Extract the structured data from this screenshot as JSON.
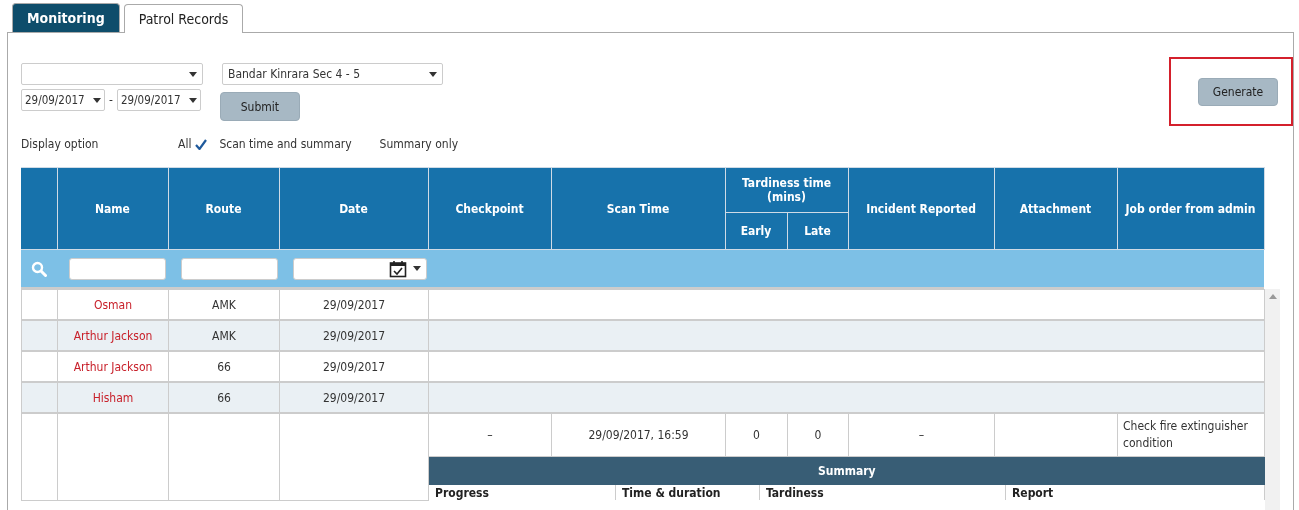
{
  "tabs": [
    {
      "label": "Monitoring",
      "selected": false
    },
    {
      "label": "Patrol Records",
      "selected": true
    }
  ],
  "filters": {
    "select_2": {
      "value": "Bandar Kinrara Sec 4 - 5"
    },
    "date_from": "29/09/2017",
    "date_separator": "-",
    "date_to": "29/09/2017",
    "submit": "Submit"
  },
  "generate_button": {
    "label": "Generate",
    "highlighted": true
  },
  "display_option": {
    "label": "Display option",
    "options": [
      {
        "label": "All",
        "selected": true
      },
      {
        "label": "Scan time and summary",
        "selected": false
      },
      {
        "label": "Summary only",
        "selected": false
      }
    ]
  },
  "table": {
    "columns": [
      {},
      {
        "label": "Name"
      },
      {
        "label": "Route"
      },
      {
        "label": "Date"
      },
      {
        "label": "Checkpoint"
      },
      {
        "label": "Scan Time"
      },
      {
        "label": "Tardiness time (mins)",
        "children": [
          {
            "label": "Early"
          },
          {
            "label": "Late"
          }
        ]
      },
      {
        "label": "Incident Reported"
      },
      {
        "label": "Attachment"
      },
      {
        "label": "Job order from admin"
      }
    ],
    "rows": [
      {
        "name": "Osman",
        "route": "AMK",
        "date": "29/09/2017"
      },
      {
        "name": "Arthur Jackson",
        "route": "AMK",
        "date": "29/09/2017"
      },
      {
        "name": "Arthur Jackson",
        "route": "66",
        "date": "29/09/2017"
      },
      {
        "name": "Hisham",
        "route": "66",
        "date": "29/09/2017"
      }
    ],
    "detail": {
      "checkpoint": "–",
      "scan_time": "29/09/2017, 16:59",
      "early": "0",
      "late": "0",
      "incident": "–",
      "job_order": "Check fire extinguisher condition"
    },
    "summary": {
      "title": "Summary",
      "columns": [
        "Progress",
        "Time & duration",
        "Tardiness",
        "Report"
      ]
    }
  }
}
